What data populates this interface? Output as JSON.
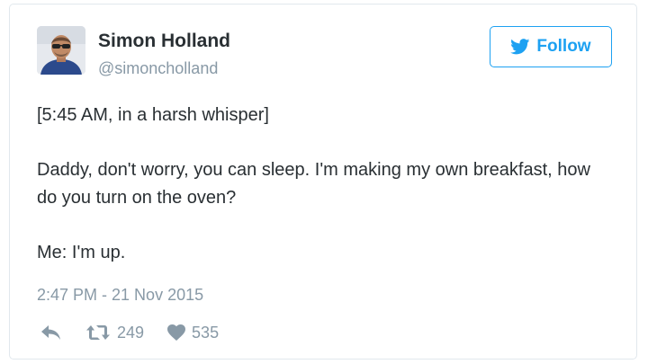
{
  "user": {
    "display_name": "Simon Holland",
    "handle": "@simoncholland"
  },
  "follow_button": {
    "label": "Follow"
  },
  "tweet": {
    "paragraphs": [
      "[5:45 AM, in a harsh whisper]",
      "Daddy, don't worry, you can sleep. I'm making my own breakfast, how do you turn on the oven?",
      "Me: I'm up."
    ],
    "timestamp": "2:47 PM - 21 Nov 2015"
  },
  "actions": {
    "reply_icon": "reply-arrow-icon",
    "retweet_icon": "retweet-icon",
    "retweet_count": "249",
    "like_icon": "heart-icon",
    "like_count": "535"
  },
  "colors": {
    "accent": "#1da1f2",
    "text": "#292f33",
    "muted": "#8899a6",
    "border": "#e1e8ed"
  }
}
